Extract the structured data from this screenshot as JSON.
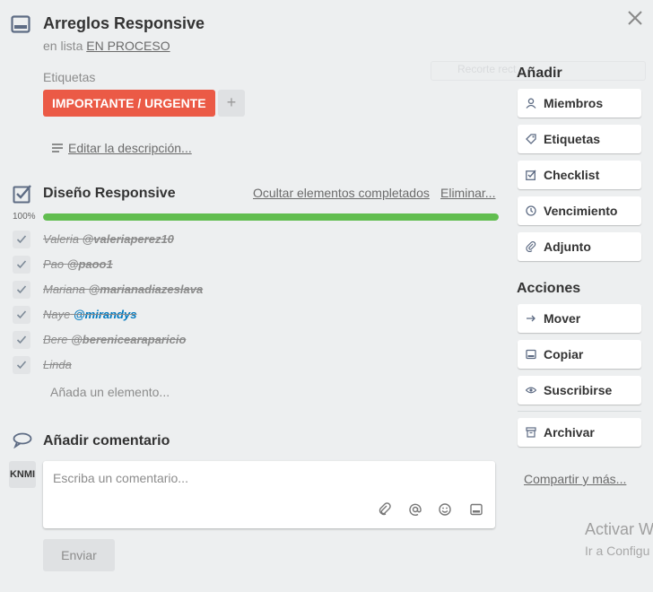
{
  "card": {
    "title": "Arreglos Responsive",
    "in_list_prefix": "en lista",
    "list_name": "EN PROCESO"
  },
  "labels": {
    "heading": "Etiquetas",
    "items": [
      {
        "text": "IMPORTANTE / URGENTE",
        "color": "#eb5a46"
      }
    ],
    "add_symbol": "+"
  },
  "ghost_hint": "Recorte rect",
  "description": {
    "link": "Editar la descripción..."
  },
  "checklist": {
    "title": "Diseño Responsive",
    "hide_completed": "Ocultar elementos completados",
    "delete": "Eliminar...",
    "progress_label": "100%",
    "progress": 1.0,
    "progress_color": "#61bd4f",
    "items": [
      {
        "name": "Valeria",
        "mention": "@valeriaperez10",
        "checked": true,
        "mention_active": false
      },
      {
        "name": "Pao",
        "mention": "@paoo1",
        "checked": true,
        "mention_active": false
      },
      {
        "name": "Mariana",
        "mention": "@marianadiazeslava",
        "checked": true,
        "mention_active": false
      },
      {
        "name": "Naye",
        "mention": "@mirandys",
        "checked": true,
        "mention_active": true
      },
      {
        "name": "Bere",
        "mention": "@berenicearaparicio",
        "checked": true,
        "mention_active": false
      },
      {
        "name": "Linda",
        "mention": "",
        "checked": true,
        "mention_active": false
      }
    ],
    "add_item": "Añada un elemento..."
  },
  "comment": {
    "heading": "Añadir comentario",
    "avatar_initials": "KNMI",
    "placeholder": "Escriba un comentario...",
    "tools": [
      "paperclip-icon",
      "at-icon",
      "emoji-icon",
      "card-icon"
    ],
    "send": "Enviar"
  },
  "sidebar": {
    "add_heading": "Añadir",
    "add_buttons": [
      {
        "label": "Miembros",
        "icon": "person-icon"
      },
      {
        "label": "Etiquetas",
        "icon": "tag-icon"
      },
      {
        "label": "Checklist",
        "icon": "checkbox-icon"
      },
      {
        "label": "Vencimiento",
        "icon": "clock-icon"
      },
      {
        "label": "Adjunto",
        "icon": "paperclip-icon"
      }
    ],
    "actions_heading": "Acciones",
    "action_buttons": [
      {
        "label": "Mover",
        "icon": "arrow-right-icon"
      },
      {
        "label": "Copiar",
        "icon": "card-icon"
      },
      {
        "label": "Suscribirse",
        "icon": "eye-icon"
      },
      {
        "label": "Archivar",
        "icon": "archive-icon"
      }
    ],
    "share": "Compartir y más..."
  },
  "windows_watermark": {
    "title": "Activar W",
    "subtitle": "Ir a Configu"
  }
}
